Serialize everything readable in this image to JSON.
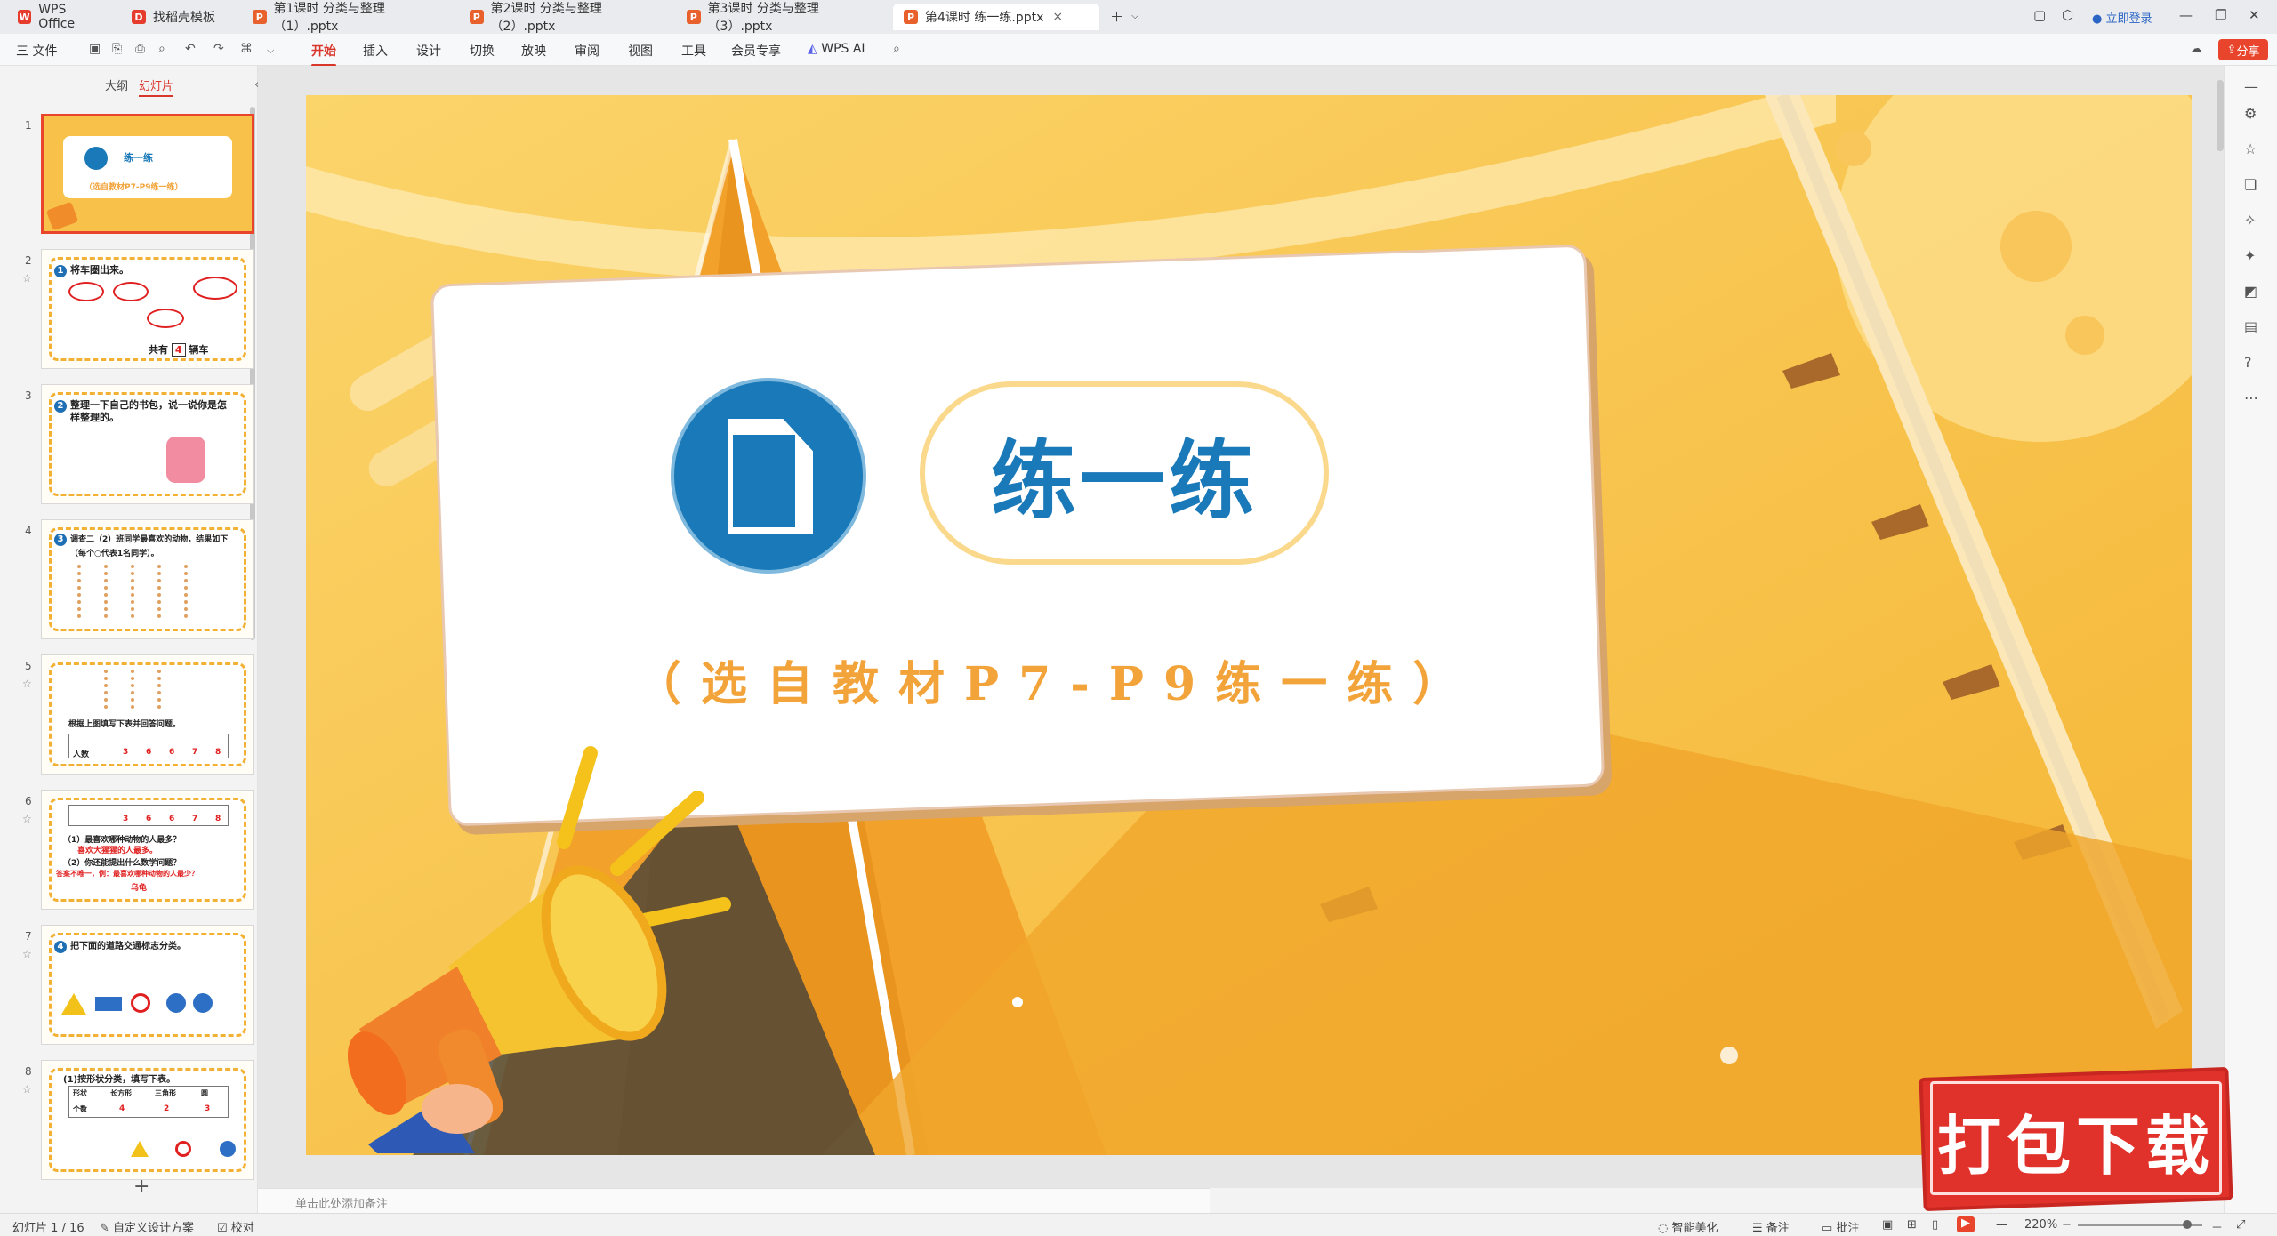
{
  "tabs": [
    {
      "label": "WPS Office",
      "icon": "wps-logo-icon"
    },
    {
      "label": "找稻壳模板",
      "icon": "docer-icon"
    },
    {
      "label": "第1课时 分类与整理（1）.pptx",
      "icon": "ppt-file-icon"
    },
    {
      "label": "第2课时 分类与整理（2）.pptx",
      "icon": "ppt-file-icon"
    },
    {
      "label": "第3课时 分类与整理（3）.pptx",
      "icon": "ppt-file-icon"
    },
    {
      "label": "第4课时 练一练.pptx",
      "icon": "ppt-file-icon",
      "active": true
    }
  ],
  "titlebar": {
    "login": "立即登录"
  },
  "ribbon": {
    "file_menu": "三 文件",
    "tabs": [
      "开始",
      "插入",
      "设计",
      "切换",
      "放映",
      "审阅",
      "视图",
      "工具",
      "会员专享",
      "WPS AI"
    ],
    "active_tab": "开始",
    "share": "分享"
  },
  "left_panel": {
    "tab_outline": "大纲",
    "tab_slides": "幻灯片",
    "slides": [
      {
        "num": "1",
        "title": "练一练",
        "sub": "（选自教材P7-P9练一练）"
      },
      {
        "num": "2",
        "title": "将车圈出来。",
        "line2": "共有",
        "answer": "4",
        "unit": "辆车"
      },
      {
        "num": "3",
        "title": "整理一下自己的书包，说一说你是怎",
        "line2": "样整理的。"
      },
      {
        "num": "4",
        "title": "调查二（2）班同学最喜欢的动物，结果如下",
        "line2": "（每个○代表1名同学）。"
      },
      {
        "num": "5",
        "title": "根据上图填写下表并回答问题。",
        "row_label": "人数",
        "values": [
          "3",
          "6",
          "6",
          "7",
          "8"
        ]
      },
      {
        "num": "6",
        "q1": "（1）最喜欢哪种动物的人最多？",
        "a1": "喜欢大猩猩的人最多。",
        "q2": "（2）你还能提出什么数学问题？",
        "a2": "答案不唯一，例：最喜欢哪种动物的人最少？",
        "a3": "乌龟",
        "values": [
          "3",
          "6",
          "6",
          "7",
          "8"
        ]
      },
      {
        "num": "7",
        "title": "把下面的道路交通标志分类。"
      },
      {
        "num": "8",
        "title": "(1)按形状分类，填写下表。",
        "headers": [
          "形状",
          "长方形",
          "三角形",
          "圆"
        ],
        "row_label": "个数",
        "values": [
          "4",
          "2",
          "3"
        ]
      }
    ]
  },
  "slide": {
    "title": "练一练",
    "subtitle": "（选自教材P7-P9练一练）"
  },
  "notes_placeholder": "单击此处添加备注",
  "statusbar": {
    "slide_counter": "幻灯片 1 / 16",
    "design": "自定义设计方案",
    "proof": "校对",
    "beautify": "智能美化",
    "notes": "备注",
    "comments": "批注",
    "zoom": "220%"
  },
  "watermark": {
    "text": "打包下载"
  },
  "colors": {
    "accent_red": "#d9362b",
    "slide_bg": "#f7c14a",
    "title_blue": "#1a79b8",
    "subtitle_orange": "#f2a33a"
  }
}
